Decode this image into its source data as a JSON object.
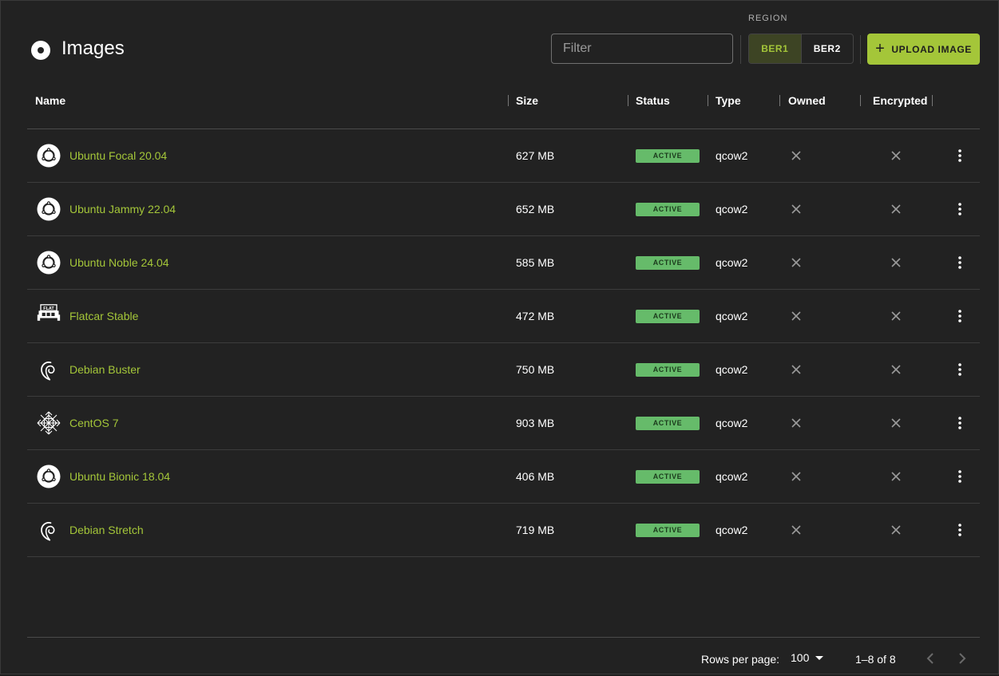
{
  "page": {
    "title": "Images"
  },
  "filter": {
    "placeholder": "Filter"
  },
  "region": {
    "label": "REGION",
    "options": [
      {
        "label": "BER1",
        "selected": true
      },
      {
        "label": "BER2",
        "selected": false
      }
    ]
  },
  "upload_button": {
    "label": "UPLOAD IMAGE"
  },
  "colors": {
    "accent": "#a4c639",
    "status_active": "#66bb6a",
    "background": "#222222"
  },
  "table": {
    "headers": {
      "name": "Name",
      "size": "Size",
      "status": "Status",
      "type": "Type",
      "owned": "Owned",
      "encrypted": "Encrypted"
    },
    "rows": [
      {
        "icon": "ubuntu-icon",
        "name": "Ubuntu Focal 20.04",
        "size": "627 MB",
        "status": "ACTIVE",
        "type": "qcow2",
        "owned": false,
        "encrypted": false
      },
      {
        "icon": "ubuntu-icon",
        "name": "Ubuntu Jammy 22.04",
        "size": "652 MB",
        "status": "ACTIVE",
        "type": "qcow2",
        "owned": false,
        "encrypted": false
      },
      {
        "icon": "ubuntu-icon",
        "name": "Ubuntu Noble 24.04",
        "size": "585 MB",
        "status": "ACTIVE",
        "type": "qcow2",
        "owned": false,
        "encrypted": false
      },
      {
        "icon": "flatcar-icon",
        "name": "Flatcar Stable",
        "size": "472 MB",
        "status": "ACTIVE",
        "type": "qcow2",
        "owned": false,
        "encrypted": false
      },
      {
        "icon": "debian-icon",
        "name": "Debian Buster",
        "size": "750 MB",
        "status": "ACTIVE",
        "type": "qcow2",
        "owned": false,
        "encrypted": false
      },
      {
        "icon": "centos-icon",
        "name": "CentOS 7",
        "size": "903 MB",
        "status": "ACTIVE",
        "type": "qcow2",
        "owned": false,
        "encrypted": false
      },
      {
        "icon": "ubuntu-icon",
        "name": "Ubuntu Bionic 18.04",
        "size": "406 MB",
        "status": "ACTIVE",
        "type": "qcow2",
        "owned": false,
        "encrypted": false
      },
      {
        "icon": "debian-icon",
        "name": "Debian Stretch",
        "size": "719 MB",
        "status": "ACTIVE",
        "type": "qcow2",
        "owned": false,
        "encrypted": false
      }
    ]
  },
  "pagination": {
    "rows_per_page_label": "Rows per page:",
    "rows_per_page": "100",
    "range": "1–8 of 8"
  }
}
